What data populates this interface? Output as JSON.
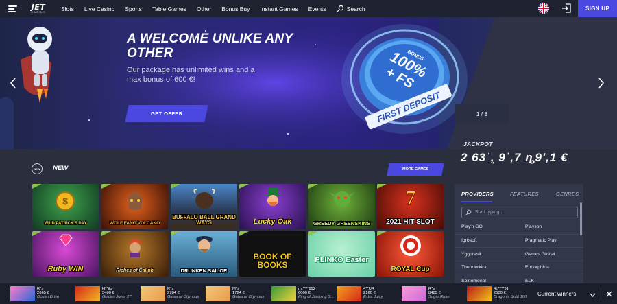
{
  "header": {
    "logo_main": "JET",
    "logo_sub": "CASINO",
    "nav": [
      "Slots",
      "Live Casino",
      "Sports",
      "Table Games",
      "Other",
      "Bonus Buy",
      "Instant Games",
      "Events"
    ],
    "search_label": "Search",
    "signup_label": "SIGN UP"
  },
  "banner": {
    "title": "A WELCOME UNLIKE ANY OTHER",
    "subtitle": "Our package has unlimited wins and a max bonus of 600 €!",
    "cta": "GET OFFER",
    "counter": "1 / 8",
    "disc_bonus": "BONUS",
    "disc_main": "100%",
    "disc_plus": "+ FS",
    "disc_ribbon": "FIRST DEPOSIT"
  },
  "jackpot": {
    "label": "JACKPOT",
    "value": "2 63ʾ,ͅ 9ʾ,7 ȵ9ʹ,1 €"
  },
  "new_section": {
    "title": "NEW",
    "icon_text": "NEW",
    "more_games": "MORE GAMES"
  },
  "games": [
    {
      "name": "WILD PATRICK'S DAY"
    },
    {
      "name": "WOLF FANG VOLCANO"
    },
    {
      "name": "BUFFALO BALL GRAND WAYS"
    },
    {
      "name": "Lucky Oak"
    },
    {
      "name": "GREEDY GREENSKINS"
    },
    {
      "name": "2021 HIT SLOT"
    },
    {
      "name": "Ruby WIN"
    },
    {
      "name": "Riches of Caliph"
    },
    {
      "name": "DRUNKEN SAILOR"
    },
    {
      "name": "BOOK OF BOOKS"
    },
    {
      "name": "PLINKO Easter"
    },
    {
      "name": "ROYAL Cup"
    }
  ],
  "providers": {
    "tabs": [
      "PROVIDERS",
      "FEATURES",
      "GENRES"
    ],
    "search_placeholder": "Start typing...",
    "rows": [
      [
        "Play'n GO",
        "Playson"
      ],
      [
        "Igrosoft",
        "Pragmatic Play"
      ],
      [
        "Yggdrasil",
        "Games Global"
      ],
      [
        "Thunderkick",
        "Endorphina"
      ],
      [
        "Spinomenal",
        "ELK"
      ]
    ]
  },
  "winners": {
    "label": "Current winners",
    "items": [
      {
        "name": "R*s",
        "amount": "2665 €",
        "game": "Ocean Drive"
      },
      {
        "name": "H**ilp",
        "amount": "5480 €",
        "game": "Golden Joker 27"
      },
      {
        "name": "R*s",
        "amount": "2784 €",
        "game": "Gates of Olympus"
      },
      {
        "name": "M*s",
        "amount": "1724 €",
        "game": "Gates of Olympus"
      },
      {
        "name": "m:****992",
        "amount": "6000 €",
        "game": "King of Jumping S..."
      },
      {
        "name": "4**UR",
        "amount": "2160 €",
        "game": "Extra Juicy"
      },
      {
        "name": "R*s",
        "amount": "8485 €",
        "game": "Sugar Rush"
      },
      {
        "name": "4L****91",
        "amount": "2500 €",
        "game": "Dragon's Gold 100"
      }
    ]
  },
  "colors": {
    "accent": "#4a48e0",
    "topbar": "#1f2231",
    "page_bg": "#2a2e3d",
    "panel_bg": "#32374a",
    "new_tag": "#8bc34a"
  }
}
